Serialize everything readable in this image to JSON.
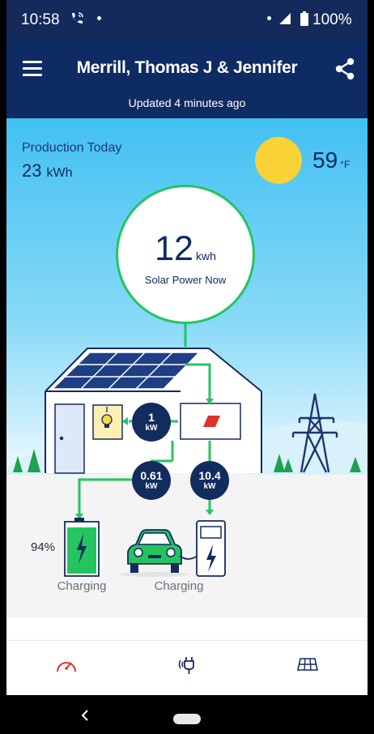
{
  "status_bar": {
    "time": "10:58",
    "battery_percent": "100%"
  },
  "header": {
    "title": "Merrill, Thomas J & Jennifer",
    "updated": "Updated 4 minutes ago"
  },
  "production": {
    "label": "Production Today",
    "value": "23",
    "unit": "kWh"
  },
  "weather": {
    "temperature": "59",
    "unit": "°F"
  },
  "solar_now": {
    "value": "12",
    "unit": "kwh",
    "label": "Solar Power Now"
  },
  "flows": {
    "home": {
      "value": "1",
      "unit": "kW"
    },
    "battery": {
      "value": "0.61",
      "unit": "kW"
    },
    "ev": {
      "value": "10.4",
      "unit": "kW"
    }
  },
  "battery": {
    "percent": "94%",
    "status": "Charging",
    "level": 0.94
  },
  "ev": {
    "status": "Charging"
  },
  "nav": {
    "items": [
      "dashboard-gauge-icon",
      "ev-charger-plug-icon",
      "solar-panel-icon"
    ],
    "active": 0
  },
  "colors": {
    "header": "#0f2b63",
    "flow_green": "#25c461",
    "bubble": "#132c5e",
    "sun": "#f8d236",
    "active_nav": "#e0322b"
  }
}
